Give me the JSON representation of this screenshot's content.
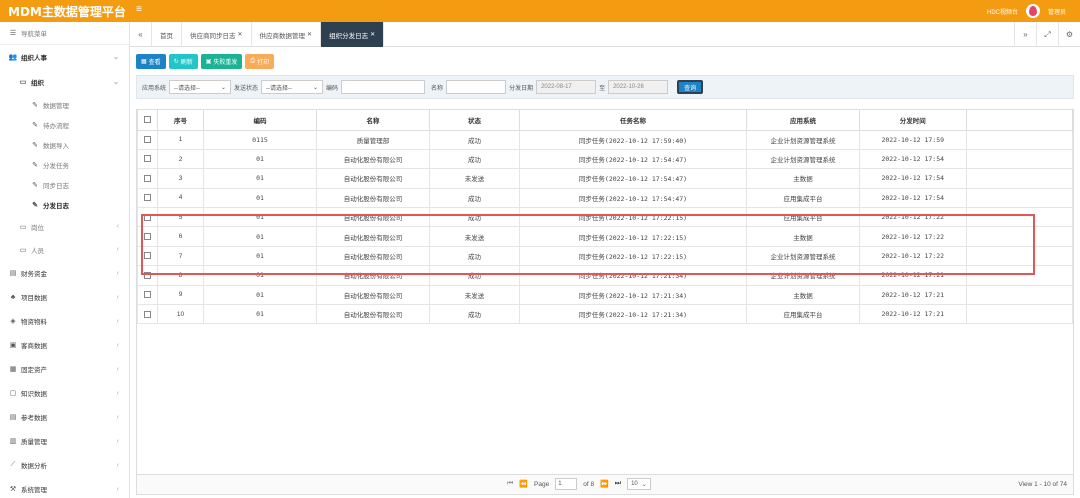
{
  "header": {
    "brand": "MDM主数据管理平台",
    "menu_icon": "≡",
    "org": "HDC视频台",
    "user": "管理员",
    "colors": {
      "header": "#f39c12",
      "active_tab": "#2f4050",
      "highlight": "#e15656"
    }
  },
  "sidebar": {
    "nav_title": "导航菜单",
    "group_org": "组织人事",
    "org_sub": "组织",
    "leaves": [
      "数据管理",
      "待办流程",
      "数据导入",
      "分发任务",
      "同步日志",
      "分发日志"
    ],
    "active_leaf": "分发日志",
    "sub_post": "岗位",
    "sub_person": "人员",
    "groups": [
      "财务资金",
      "项目数据",
      "物资物料",
      "客商数据",
      "固定资产",
      "知识数据",
      "参考数据",
      "质量管理",
      "数据分析",
      "系统管理"
    ]
  },
  "tabs": {
    "items": [
      {
        "label": "首页",
        "closable": false,
        "active": false
      },
      {
        "label": "供应商同步日志",
        "closable": true,
        "active": false
      },
      {
        "label": "供应商数据管理",
        "closable": true,
        "active": false
      },
      {
        "label": "组织分发日志",
        "closable": true,
        "active": true
      }
    ]
  },
  "toolbar": {
    "view": "查看",
    "refresh": "刷新",
    "fail_resend": "失败重发",
    "print": "打印"
  },
  "filter": {
    "app_system_label": "应用系统",
    "app_system_value": "--请选择--",
    "send_status_label": "发送状态",
    "send_status_value": "--请选择--",
    "code_label": "编码",
    "code_value": "",
    "name_label": "名称",
    "name_value": "",
    "date_label": "分发日期",
    "date_from": "2022-08-17",
    "date_to_label": "至",
    "date_to": "2022-10-26",
    "search": "查询"
  },
  "table": {
    "columns": [
      "序号",
      "编码",
      "名称",
      "状态",
      "任务名称",
      "应用系统",
      "分发时间"
    ],
    "rows": [
      {
        "no": "1",
        "code": "0115",
        "name": "质量管理部",
        "status": "成功",
        "task": "同步任务(2022-10-12 17:59:40)",
        "system": "企业计划资源管理系统",
        "time": "2022-10-12 17:59"
      },
      {
        "no": "2",
        "code": "01",
        "name": "自动化股份有限公司",
        "status": "成功",
        "task": "同步任务(2022-10-12 17:54:47)",
        "system": "企业计划资源管理系统",
        "time": "2022-10-12 17:54"
      },
      {
        "no": "3",
        "code": "01",
        "name": "自动化股份有限公司",
        "status": "未发送",
        "task": "同步任务(2022-10-12 17:54:47)",
        "system": "主数据",
        "time": "2022-10-12 17:54"
      },
      {
        "no": "4",
        "code": "01",
        "name": "自动化股份有限公司",
        "status": "成功",
        "task": "同步任务(2022-10-12 17:54:47)",
        "system": "应用集成平台",
        "time": "2022-10-12 17:54"
      },
      {
        "no": "5",
        "code": "01",
        "name": "自动化股份有限公司",
        "status": "成功",
        "task": "同步任务(2022-10-12 17:22:15)",
        "system": "应用集成平台",
        "time": "2022-10-12 17:22"
      },
      {
        "no": "6",
        "code": "01",
        "name": "自动化股份有限公司",
        "status": "未发送",
        "task": "同步任务(2022-10-12 17:22:15)",
        "system": "主数据",
        "time": "2022-10-12 17:22"
      },
      {
        "no": "7",
        "code": "01",
        "name": "自动化股份有限公司",
        "status": "成功",
        "task": "同步任务(2022-10-12 17:22:15)",
        "system": "企业计划资源管理系统",
        "time": "2022-10-12 17:22"
      },
      {
        "no": "8",
        "code": "01",
        "name": "自动化股份有限公司",
        "status": "成功",
        "task": "同步任务(2022-10-12 17:21:34)",
        "system": "企业计划资源管理系统",
        "time": "2022-10-12 17:21"
      },
      {
        "no": "9",
        "code": "01",
        "name": "自动化股份有限公司",
        "status": "未发送",
        "task": "同步任务(2022-10-12 17:21:34)",
        "system": "主数据",
        "time": "2022-10-12 17:21"
      },
      {
        "no": "10",
        "code": "01",
        "name": "自动化股份有限公司",
        "status": "成功",
        "task": "同步任务(2022-10-12 17:21:34)",
        "system": "应用集成平台",
        "time": "2022-10-12 17:21"
      }
    ]
  },
  "pager": {
    "page_label": "Page",
    "page_value": "1",
    "of_pages": "of 8",
    "page_size": "10",
    "summary": "View 1 - 10 of 74"
  }
}
